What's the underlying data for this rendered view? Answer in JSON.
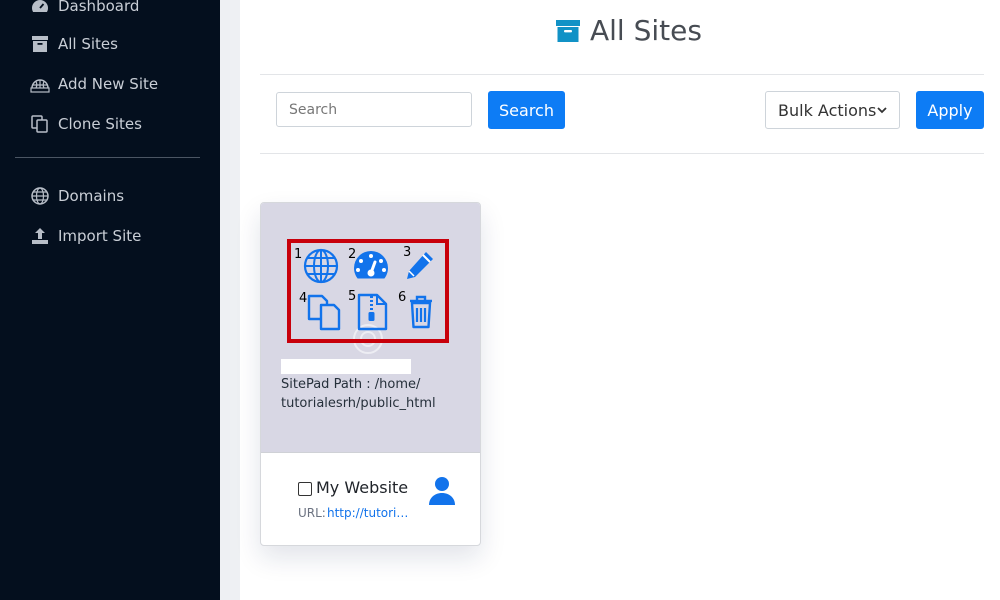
{
  "sidebar": {
    "items": [
      {
        "label": "Dashboard",
        "icon": "dashboard-icon"
      },
      {
        "label": "All Sites",
        "icon": "archive-icon"
      },
      {
        "label": "Add New Site",
        "icon": "globe-add-icon"
      },
      {
        "label": "Clone Sites",
        "icon": "clone-icon"
      },
      {
        "label": "Domains",
        "icon": "globe-icon"
      },
      {
        "label": "Import Site",
        "icon": "upload-icon"
      }
    ]
  },
  "header": {
    "title": "All Sites",
    "icon": "archive-icon"
  },
  "toolbar": {
    "search_placeholder": "Search",
    "search_value": "",
    "search_button": "Search",
    "bulk_actions_selected": "Bulk Actions",
    "apply_button": "Apply"
  },
  "site_card": {
    "sitepad_path": "SitePad Path : /home/ tutorialesrh/public_html",
    "site_name": "My Website",
    "url_label": "URL:",
    "url_value": "http://tutorialesrh.com",
    "actions": [
      {
        "number": "1",
        "icon": "globe-icon"
      },
      {
        "number": "2",
        "icon": "dashboard-gauge-icon"
      },
      {
        "number": "3",
        "icon": "pencil-edit-icon"
      },
      {
        "number": "4",
        "icon": "clone-copy-icon"
      },
      {
        "number": "5",
        "icon": "zip-file-icon"
      },
      {
        "number": "6",
        "icon": "trash-icon"
      }
    ]
  },
  "colors": {
    "sidebar_bg": "#040f1e",
    "primary": "#0d7cf5",
    "title_icon": "#1192c6",
    "highlight": "#c8000b",
    "card_top_bg": "#d8d7e4"
  }
}
